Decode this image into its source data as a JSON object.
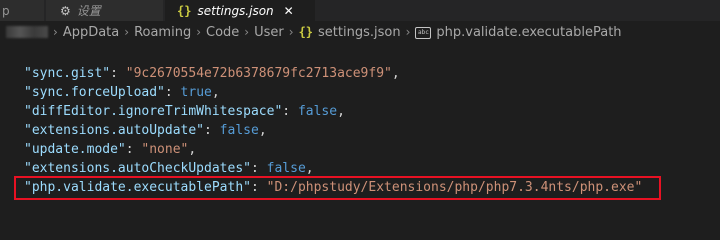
{
  "tabs": [
    {
      "label": "p",
      "active": false
    },
    {
      "label": "设置",
      "active": false
    },
    {
      "label": "settings.json",
      "active": true
    }
  ],
  "breadcrumb": [
    "AppData",
    "Roaming",
    "Code",
    "User",
    "settings.json",
    "php.validate.executablePath"
  ],
  "editor": {
    "lines": [
      {
        "key": "\"sync.gist\"",
        "value": "\"9c2670554e72b6378679fc2713ace9f9\"",
        "value_type": "string"
      },
      {
        "key": "\"sync.forceUpload\"",
        "value": "true",
        "value_type": "boolean"
      },
      {
        "key": "\"diffEditor.ignoreTrimWhitespace\"",
        "value": "false",
        "value_type": "boolean"
      },
      {
        "key": "\"extensions.autoUpdate\"",
        "value": "false",
        "value_type": "boolean"
      },
      {
        "key": "\"update.mode\"",
        "value": "\"none\"",
        "value_type": "string"
      },
      {
        "key": "\"extensions.autoCheckUpdates\"",
        "value": "false",
        "value_type": "boolean"
      },
      {
        "key": "\"php.validate.executablePath\"",
        "value": "\"D:/phpstudy/Extensions/php/php7.3.4nts/php.exe\"",
        "value_type": "string"
      }
    ],
    "punctuation": {
      "colon": ": ",
      "comma": ","
    }
  },
  "icons": {
    "json_file": "json-braces-icon",
    "settings_ui": "gear-icon",
    "property": "property-icon",
    "close": "close-icon"
  },
  "colors": {
    "background": "#1e1e1e",
    "key": "#9cdcfe",
    "string": "#ce9178",
    "boolean": "#569cd6",
    "highlight_box": "#e81123"
  }
}
